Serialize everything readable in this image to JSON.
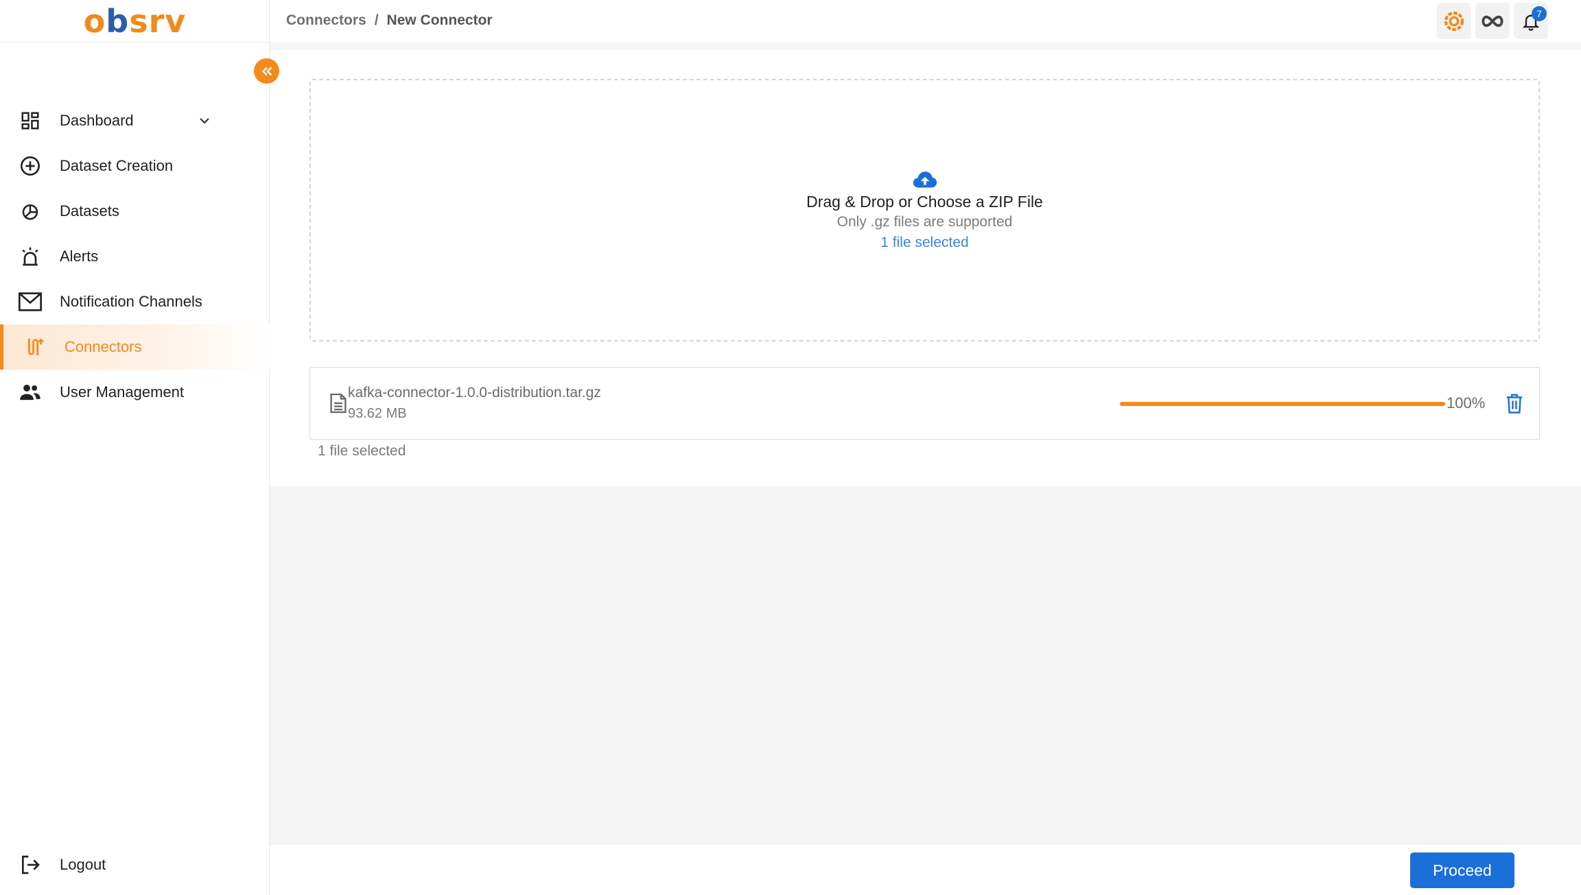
{
  "app": {
    "logo_part1": "o",
    "logo_part2": "b",
    "logo_part3": "srv"
  },
  "header": {
    "breadcrumb": [
      "Connectors",
      "New Connector"
    ],
    "breadcrumb_separator": "/",
    "notifications_count": "7"
  },
  "sidebar": {
    "items": [
      {
        "label": "Dashboard",
        "icon": "dashboard-icon",
        "expandable": true
      },
      {
        "label": "Dataset Creation",
        "icon": "plus-circle-icon"
      },
      {
        "label": "Datasets",
        "icon": "datasets-icon"
      },
      {
        "label": "Alerts",
        "icon": "siren-icon"
      },
      {
        "label": "Notification Channels",
        "icon": "mail-icon"
      },
      {
        "label": "Connectors",
        "icon": "connectors-icon",
        "active": true
      },
      {
        "label": "User Management",
        "icon": "users-icon"
      }
    ],
    "logout_label": "Logout"
  },
  "upload": {
    "title": "Drag & Drop or Choose a ZIP File",
    "subtitle": "Only .gz files are supported",
    "selected_text": "1 file selected"
  },
  "file": {
    "name": "kafka-connector-1.0.0-distribution.tar.gz",
    "size": "93.62 MB",
    "progress_percent": 100,
    "progress_label": "100%"
  },
  "below_selected_text": "1 file selected",
  "footer": {
    "proceed_label": "Proceed"
  },
  "colors": {
    "accent": "#f28a1c",
    "primary": "#1a6fd8",
    "brand_blue": "#2f5da8"
  }
}
